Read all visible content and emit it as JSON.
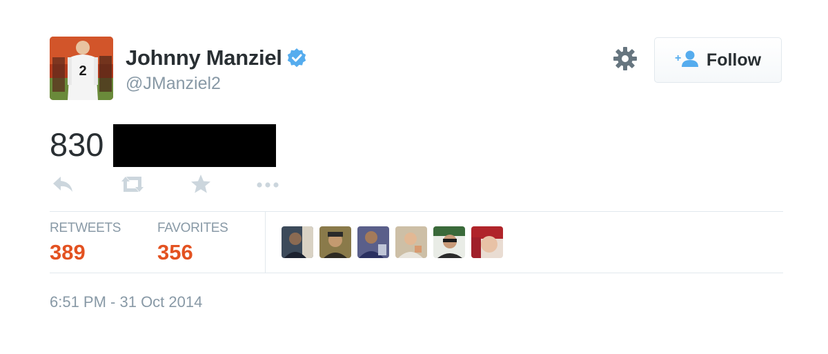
{
  "user": {
    "fullname": "Johnny Manziel",
    "handle": "@JManziel2",
    "verified": true,
    "avatar_icon": "profile-photo"
  },
  "header": {
    "follow_label": "Follow",
    "settings_icon": "gear-icon",
    "follow_icon": "add-person-icon"
  },
  "tweet": {
    "text": "830",
    "redacted": true,
    "actions": [
      "reply-icon",
      "retweet-icon",
      "favorite-icon",
      "more-icon"
    ]
  },
  "stats": {
    "retweets_label": "RETWEETS",
    "retweets_value": "389",
    "favorites_label": "FAVORITES",
    "favorites_value": "356"
  },
  "favoriters": [
    {
      "icon": "user-avatar-1"
    },
    {
      "icon": "user-avatar-2"
    },
    {
      "icon": "user-avatar-3"
    },
    {
      "icon": "user-avatar-4"
    },
    {
      "icon": "user-avatar-5"
    },
    {
      "icon": "user-avatar-6"
    }
  ],
  "timestamp": "6:51 PM - 31 Oct 2014",
  "colors": {
    "accent_orange": "#e35221",
    "verified_blue": "#55acee",
    "muted_gray": "#8899a6",
    "text_dark": "#292f33",
    "border": "#e1e8ed"
  }
}
